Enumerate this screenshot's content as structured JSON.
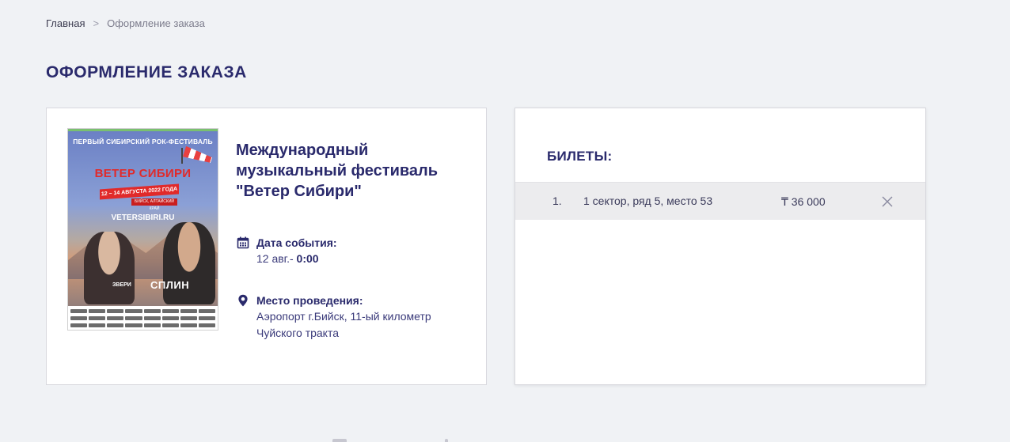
{
  "breadcrumb": {
    "home": "Главная",
    "separator": ">",
    "current": "Оформление заказа"
  },
  "page": {
    "title": "ОФОРМЛЕНИЕ ЗАКАЗА"
  },
  "event": {
    "poster": {
      "festival_line": "ПЕРВЫЙ СИБИРСКИЙ РОК-ФЕСТИВАЛЬ",
      "name": "ВЕТЕР СИБИРИ",
      "dates": "12 – 14 АВГУСТА 2022 ГОДА",
      "place": "БИЙСК, АЛТАЙСКИЙ КРАЙ",
      "site": "VETERSIBIRI.RU",
      "band_left": "ЗВЕРИ",
      "band_right": "СПЛИН"
    },
    "title": "Международный музыкальный фестиваль \"Ветер Сибири\"",
    "date_label": "Дата события:",
    "date_value": "12 авг.- ",
    "time_value": "0:00",
    "place_label": "Место проведения:",
    "place_value": "Аэропорт г.Бийск, 11-ый километр Чуйского тракта"
  },
  "tickets": {
    "title": "БИЛЕТЫ:",
    "items": [
      {
        "number": "1.",
        "seat": "1 сектор, ряд 5, место 53",
        "price": "₸ 36 000"
      }
    ]
  },
  "colors": {
    "background": "#f0f2f5",
    "accent": "#2a2a6c",
    "row_bg": "#ececee"
  },
  "icons": {
    "date": "calendar-icon",
    "place": "location-pin-icon",
    "remove": "close-icon"
  }
}
